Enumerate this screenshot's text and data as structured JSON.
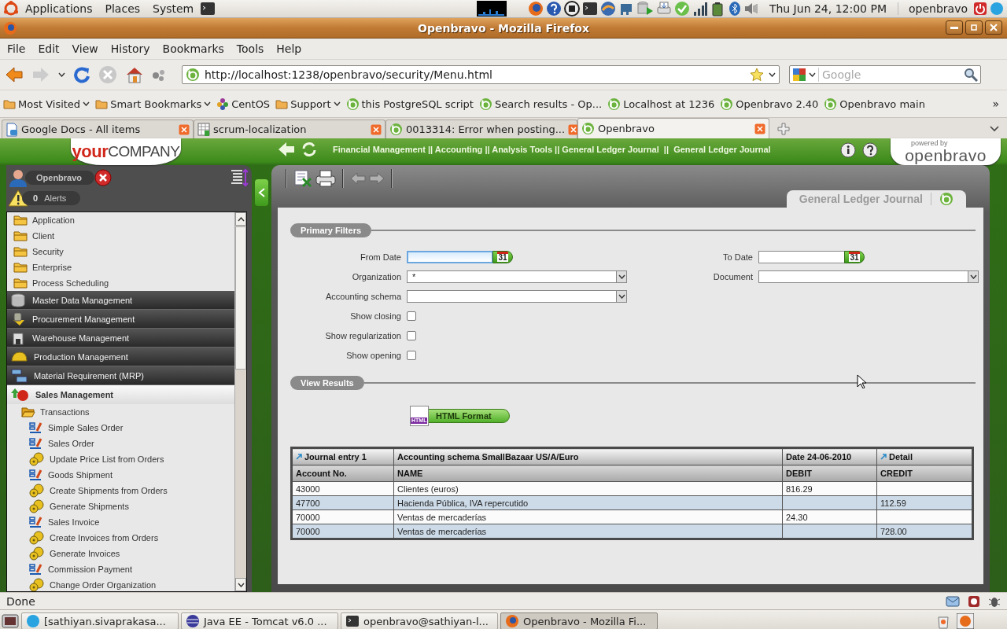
{
  "panel": {
    "menus": [
      "Applications",
      "Places",
      "System"
    ],
    "clock": "Thu Jun 24, 12:00 PM",
    "user": "openbravo"
  },
  "window": {
    "title": "Openbravo - Mozilla Firefox"
  },
  "menubar": [
    "File",
    "Edit",
    "View",
    "History",
    "Bookmarks",
    "Tools",
    "Help"
  ],
  "navbar": {
    "url": "http://localhost:1238/openbravo/security/Menu.html",
    "search_placeholder": "Google"
  },
  "bookmarks": [
    {
      "label": "Most Visited",
      "kind": "folder",
      "dropdown": true
    },
    {
      "label": "Smart Bookmarks",
      "kind": "folder",
      "dropdown": true
    },
    {
      "label": "CentOS",
      "kind": "site",
      "dropdown": false
    },
    {
      "label": "Support",
      "kind": "folder",
      "dropdown": true
    },
    {
      "label": "this PostgreSQL script",
      "kind": "openbravo",
      "dropdown": false
    },
    {
      "label": "Search results - Op...",
      "kind": "openbravo",
      "dropdown": false
    },
    {
      "label": "Localhost at 1236",
      "kind": "openbravo",
      "dropdown": false
    },
    {
      "label": "Openbravo 2.40",
      "kind": "openbravo",
      "dropdown": false
    },
    {
      "label": "Openbravo main",
      "kind": "openbravo",
      "dropdown": false
    }
  ],
  "bookmarks_more": "»",
  "browser_tabs": [
    {
      "label": "Google Docs - All items",
      "kind": "doc",
      "selected": false
    },
    {
      "label": "scrum-localization",
      "kind": "sheet",
      "selected": false
    },
    {
      "label": "0013314: Error when posting...",
      "kind": "openbravo",
      "selected": false
    },
    {
      "label": "Openbravo",
      "kind": "openbravo",
      "selected": true
    }
  ],
  "app": {
    "logo": {
      "bold": "your",
      "rest": "COMPANY"
    },
    "breadcrumb": "Financial Management || Accounting || Analysis Tools || General Ledger Journal  ||  General Ledger Journal",
    "powered_by": "powered by",
    "brand": "openbravo"
  },
  "sidebar": {
    "user": "Openbravo",
    "alerts_count": "0",
    "alerts_label": "Alerts",
    "menu": [
      {
        "label": "Application",
        "kind": "folder",
        "expanded": false
      },
      {
        "label": "Client",
        "kind": "folder",
        "expanded": false
      },
      {
        "label": "Security",
        "kind": "folder",
        "expanded": false
      },
      {
        "label": "Enterprise",
        "kind": "folder",
        "expanded": false
      },
      {
        "label": "Process Scheduling",
        "kind": "folder",
        "expanded": false
      },
      {
        "label": "Master Data Management",
        "kind": "section",
        "expanded": false
      },
      {
        "label": "Procurement Management",
        "kind": "section",
        "expanded": false
      },
      {
        "label": "Warehouse Management",
        "kind": "section",
        "expanded": false
      },
      {
        "label": "Production Management",
        "kind": "section",
        "expanded": false
      },
      {
        "label": "Material Requirement (MRP)",
        "kind": "section",
        "expanded": false
      },
      {
        "label": "Sales Management",
        "kind": "section",
        "expanded": true,
        "children": [
          {
            "label": "Transactions",
            "kind": "folder",
            "expanded": true,
            "children": [
              {
                "label": "Simple Sales Order",
                "kind": "window"
              },
              {
                "label": "Sales Order",
                "kind": "window"
              },
              {
                "label": "Update Price List from Orders",
                "kind": "process"
              },
              {
                "label": "Goods Shipment",
                "kind": "window"
              },
              {
                "label": "Create Shipments from Orders",
                "kind": "process"
              },
              {
                "label": "Generate Shipments",
                "kind": "process"
              },
              {
                "label": "Sales Invoice",
                "kind": "window"
              },
              {
                "label": "Create Invoices from Orders",
                "kind": "process"
              },
              {
                "label": "Generate Invoices",
                "kind": "process"
              },
              {
                "label": "Commission Payment",
                "kind": "window"
              },
              {
                "label": "Change Order Organization",
                "kind": "process"
              }
            ]
          }
        ]
      }
    ]
  },
  "page": {
    "title": "General Ledger Journal",
    "filters_title": "Primary Filters",
    "left_fields": [
      {
        "label": "From Date",
        "kind": "date",
        "calendar_day": "31",
        "focused": true
      },
      {
        "label": "Organization",
        "kind": "select",
        "value": "*"
      },
      {
        "label": "Accounting schema",
        "kind": "select"
      },
      {
        "label": "Show closing",
        "kind": "checkbox",
        "checked": false
      },
      {
        "label": "Show regularization",
        "kind": "checkbox",
        "checked": false
      },
      {
        "label": "Show opening",
        "kind": "checkbox",
        "checked": false
      }
    ],
    "right_fields": [
      {
        "label": "To Date",
        "kind": "date",
        "calendar_day": "31",
        "focused": false
      },
      {
        "label": "Document",
        "kind": "select"
      }
    ],
    "results_title": "View Results",
    "html_badge": "HTML",
    "html_button": "HTML Format",
    "table": {
      "group_header": [
        {
          "text": "Journal entry 1",
          "kind": "link"
        },
        {
          "text": "Accounting schema SmallBazaar US/A/Euro",
          "kind": "plain"
        },
        {
          "text": "Date 24-06-2010",
          "kind": "plain"
        },
        {
          "text": "Detail",
          "kind": "link"
        }
      ],
      "columns": [
        "Account No.",
        "NAME",
        "DEBIT",
        "CREDIT"
      ],
      "rows": [
        [
          "43000",
          "Clientes (euros)",
          "816.29",
          null
        ],
        [
          "47700",
          "Hacienda Pública, IVA repercutido",
          null,
          "112.59"
        ],
        [
          "70000",
          "Ventas de mercaderías",
          "24.30",
          null
        ],
        [
          "70000",
          "Ventas de mercaderías",
          null,
          "728.00"
        ]
      ]
    }
  },
  "statusbar": {
    "text": "Done"
  },
  "taskbar": [
    {
      "label": "[sathiyan.sivaprakasa...",
      "kind": "chat",
      "selected": false
    },
    {
      "label": "Java EE - Tomcat v6.0 ...",
      "kind": "ide",
      "selected": false
    },
    {
      "label": "openbravo@sathiyan-l...",
      "kind": "terminal",
      "selected": false
    },
    {
      "label": "Openbravo - Mozilla Fi...",
      "kind": "browser",
      "selected": true
    }
  ]
}
